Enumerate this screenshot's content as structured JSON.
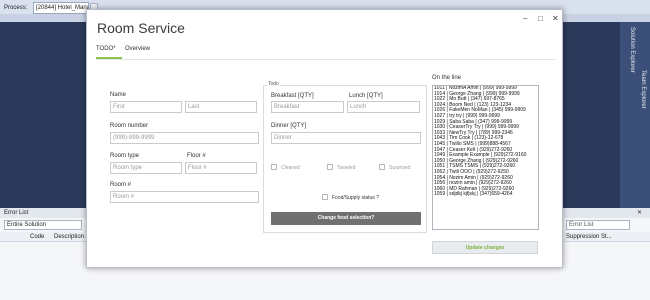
{
  "vs": {
    "process_label": "Process:",
    "process_value": "[20844] Hotel_Mana",
    "sidebar": [
      "Solution Explorer",
      "Team Explorer"
    ],
    "error_list": {
      "title": "Error List",
      "scope": "Entire Solution",
      "search_placeholder": "Error List",
      "columns": [
        "Code",
        "Description",
        "Suppression St..."
      ]
    }
  },
  "window": {
    "title": "Room Service",
    "tabs": [
      {
        "label": "TODO*",
        "active": true
      },
      {
        "label": "Overview",
        "active": false
      }
    ],
    "controls": [
      "–",
      "□",
      "✕"
    ],
    "form": {
      "name_label": "Name",
      "first_placeholder": "First",
      "last_placeholder": "Last",
      "room_number_label": "Room number",
      "room_number_placeholder": "(999)-999-9999",
      "room_type_label": "Room type",
      "room_type_placeholder": "Room type",
      "floor_label": "Floor #",
      "floor_placeholder": "Floor #",
      "room_label": "Room #",
      "room_placeholder": "Room #"
    },
    "todo": {
      "group_title": "Todo",
      "breakfast_label": "Breakfast [QTY]",
      "breakfast_placeholder": "Breakfast",
      "lunch_label": "Lunch [QTY]",
      "lunch_placeholder": "Lunch",
      "dinner_label": "Dinner [QTY]",
      "dinner_placeholder": "Dinner",
      "checks": [
        "Cleaned",
        "Toweled",
        "Surprised"
      ],
      "status_label": "Food/Supply status ?",
      "change_button": "Change food selection?"
    },
    "online": {
      "title": "On the line",
      "rows": [
        "1011 | NozimA  Amin | (999) 999-9999",
        "1014 | George  Zhang | (999) 999-9999",
        "1022 | Mo  Butt | (347) 697-8765",
        "1024 | Boom  Ned | (123) 123-1234",
        "1026 | FakeMen  NoMan | (345) 999-9909",
        "1027 | try  try | (999) 999-9999",
        "1029 | Saba  Saba | (347) 999-9999",
        "1030 | CeaserTry  Try | (999) 999-9999",
        "1033 | NewTry  Try | (789) 999-2346",
        "1043 | Tim  Cook | (123)-12-678",
        "1045 | Twilio  SMS | (999)888-4567",
        "1047 | Ceaser  Kelt | (929)272-9260",
        "1049 | Example  Example | (929)272-9160",
        "1050 | George  Zhang | (929)272-9260",
        "1051 | TSMS  TSMS | (929)272-9260",
        "1052 | Twili  OOO | (929)272-9250",
        "1054 | Nozim  Amin | (929)272-9260",
        "1056 | nozim  amin | (929)272-9260",
        "1060 | MD  Rahman | (929)272-9260",
        "1059 | sdjdkj  kjfjskj | (347)659-4264"
      ],
      "update_button": "Update changes"
    }
  }
}
